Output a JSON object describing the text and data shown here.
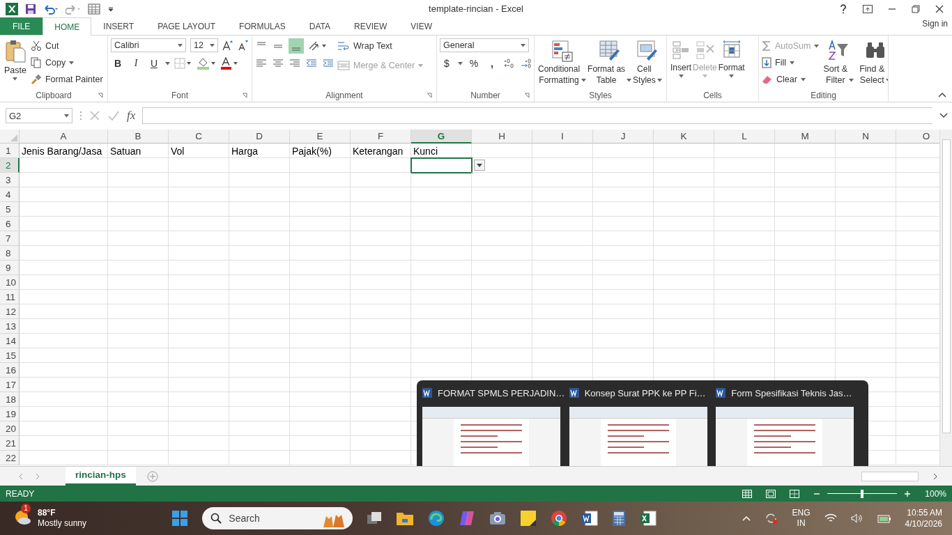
{
  "window": {
    "title": "template-rincian - Excel",
    "sign_in": "Sign in"
  },
  "ribbon_tabs": [
    {
      "label": "FILE",
      "kind": "file",
      "selected": false
    },
    {
      "label": "HOME",
      "kind": "tab",
      "selected": true
    },
    {
      "label": "INSERT",
      "kind": "tab",
      "selected": false
    },
    {
      "label": "PAGE LAYOUT",
      "kind": "tab",
      "selected": false
    },
    {
      "label": "FORMULAS",
      "kind": "tab",
      "selected": false
    },
    {
      "label": "DATA",
      "kind": "tab",
      "selected": false
    },
    {
      "label": "REVIEW",
      "kind": "tab",
      "selected": false
    },
    {
      "label": "VIEW",
      "kind": "tab",
      "selected": false
    }
  ],
  "ribbon": {
    "clipboard": {
      "title": "Clipboard",
      "paste": "Paste",
      "cut": "Cut",
      "copy": "Copy",
      "format_painter": "Format Painter"
    },
    "font": {
      "title": "Font",
      "font_name": "Calibri",
      "font_size": "12",
      "bold": "B",
      "italic": "I",
      "underline": "U"
    },
    "alignment": {
      "title": "Alignment",
      "wrap_text": "Wrap Text",
      "merge_center": {
        "label": "Merge & Center",
        "disabled": true
      }
    },
    "number": {
      "title": "Number",
      "format": "General",
      "currency": "$",
      "percent": "%",
      "comma": ","
    },
    "styles": {
      "title": "Styles",
      "items": [
        "Conditional\nFormatting",
        "Format as\nTable",
        "Cell\nStyles"
      ]
    },
    "cells": {
      "title": "Cells",
      "items": [
        {
          "label": "Insert",
          "disabled": false
        },
        {
          "label": "Delete",
          "disabled": true
        },
        {
          "label": "Format",
          "disabled": false
        }
      ]
    },
    "editing": {
      "title": "Editing",
      "autosum": {
        "label": "AutoSum",
        "disabled": true
      },
      "fill": "Fill",
      "clear": "Clear",
      "sort_filter": "Sort &\nFilter",
      "find_select": "Find &\nSelect"
    }
  },
  "formula_bar": {
    "name_box": "G2",
    "function_symbol": "fx"
  },
  "sheet": {
    "columns": [
      {
        "label": "A",
        "selected": false
      },
      {
        "label": "B",
        "selected": false
      },
      {
        "label": "C",
        "selected": false
      },
      {
        "label": "D",
        "selected": false
      },
      {
        "label": "E",
        "selected": false
      },
      {
        "label": "F",
        "selected": false
      },
      {
        "label": "G",
        "selected": true
      },
      {
        "label": "H",
        "selected": false
      },
      {
        "label": "I",
        "selected": false
      },
      {
        "label": "J",
        "selected": false
      },
      {
        "label": "K",
        "selected": false
      },
      {
        "label": "L",
        "selected": false
      },
      {
        "label": "M",
        "selected": false
      },
      {
        "label": "N",
        "selected": false
      },
      {
        "label": "O",
        "selected": false
      }
    ],
    "rows": [
      {
        "label": "1",
        "selected": false,
        "cells": [
          "Jenis Barang/Jasa",
          "Satuan",
          "Vol",
          "Harga",
          "Pajak(%)",
          "Keterangan",
          "Kunci"
        ]
      },
      {
        "label": "2",
        "selected": true
      },
      {
        "label": "3",
        "selected": false
      },
      {
        "label": "4",
        "selected": false
      },
      {
        "label": "5",
        "selected": false
      },
      {
        "label": "6",
        "selected": false
      },
      {
        "label": "7",
        "selected": false
      },
      {
        "label": "8",
        "selected": false
      },
      {
        "label": "9",
        "selected": false
      },
      {
        "label": "10",
        "selected": false
      },
      {
        "label": "11",
        "selected": false
      },
      {
        "label": "12",
        "selected": false
      },
      {
        "label": "13",
        "selected": false
      },
      {
        "label": "14",
        "selected": false
      },
      {
        "label": "15",
        "selected": false
      },
      {
        "label": "16",
        "selected": false
      },
      {
        "label": "17",
        "selected": false
      },
      {
        "label": "18",
        "selected": false
      },
      {
        "label": "19",
        "selected": false
      },
      {
        "label": "20",
        "selected": false
      },
      {
        "label": "21",
        "selected": false
      },
      {
        "label": "22",
        "selected": false
      }
    ]
  },
  "sheet_tabs": [
    {
      "label": "rincian-hps",
      "selected": true
    }
  ],
  "status_bar": {
    "status": "READY",
    "zoom": {
      "level": 0.5,
      "reading": "100%"
    }
  },
  "taskbar_preview": [
    {
      "title": "FORMAT SPMLS PERJADIN…"
    },
    {
      "title": "Konsep Surat PPK ke PP Fi…"
    },
    {
      "title": "Form Spesifikasi Teknis Jas…"
    }
  ],
  "taskbar": {
    "weather": {
      "badge": "1",
      "temperature": "88°F",
      "condition": "Mostly sunny"
    },
    "search": {
      "placeholder": "Search"
    },
    "language": {
      "line1": "ENG",
      "line2": "IN"
    },
    "time": "10:55 AM",
    "date": "4/10/2026"
  }
}
